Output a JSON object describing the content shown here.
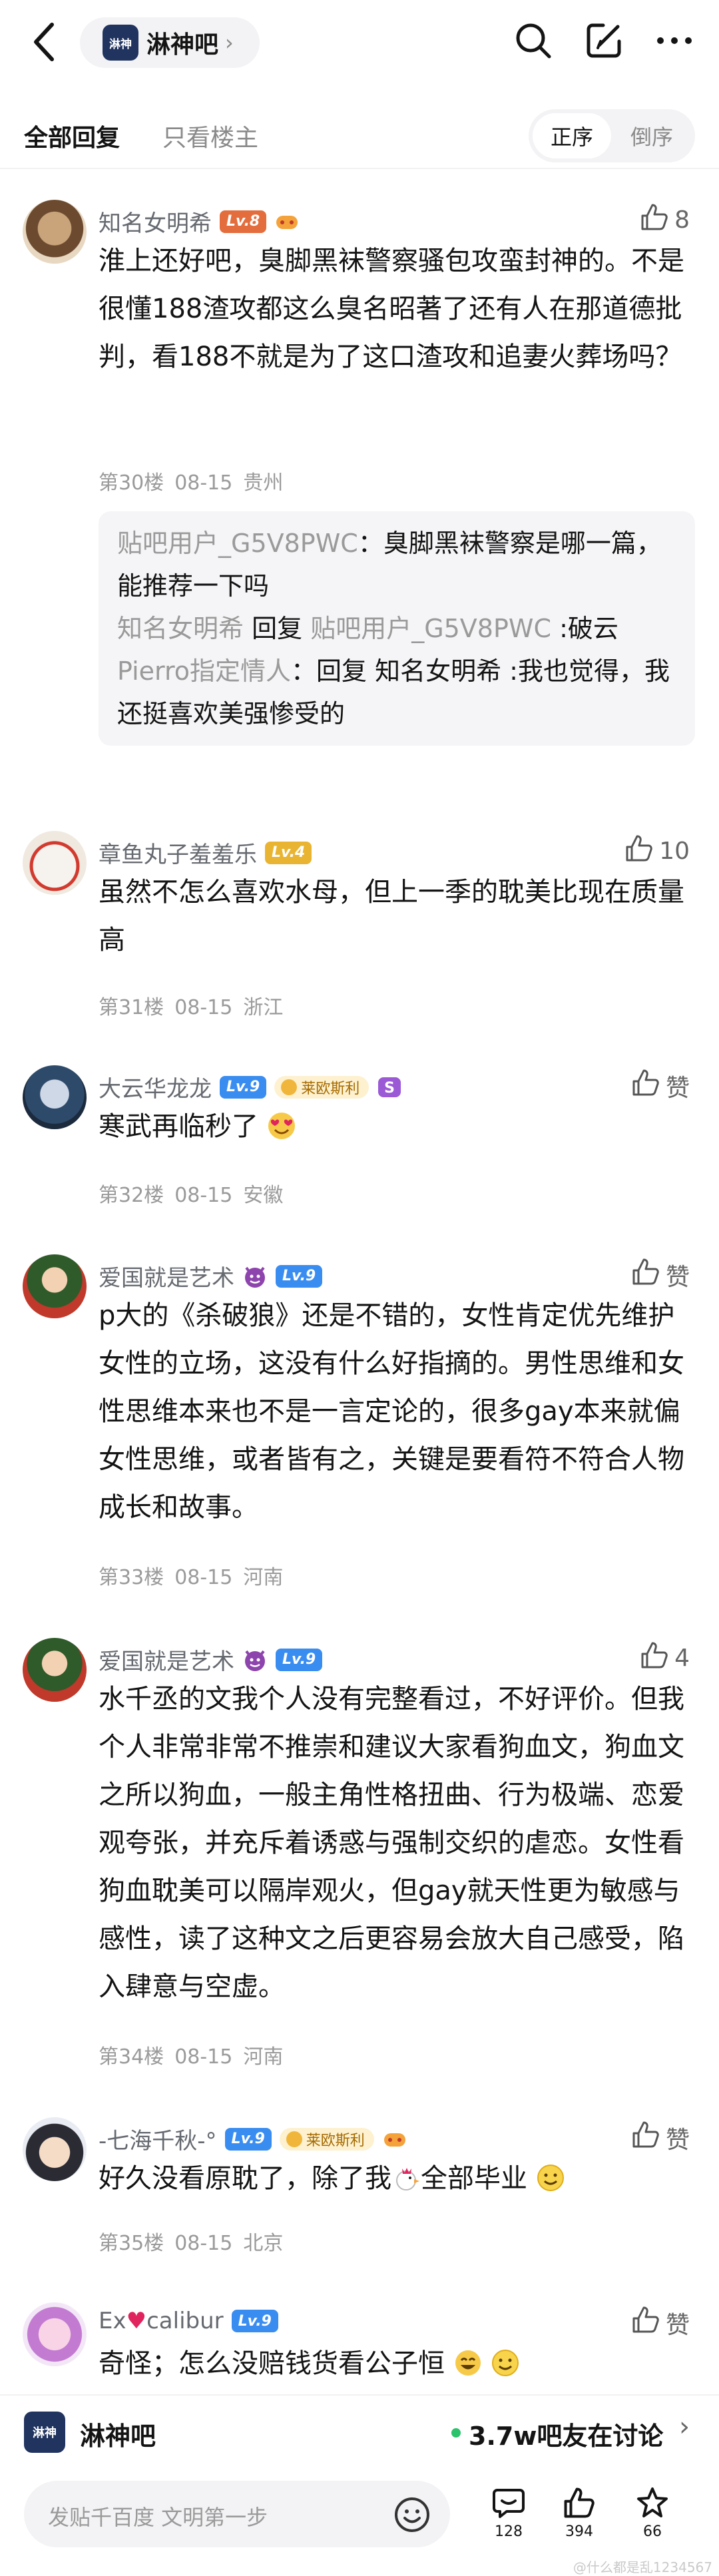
{
  "header": {
    "forum_logo_text": "淋神",
    "forum_name": "淋神吧",
    "icons": [
      "back-icon",
      "search-icon",
      "edit-icon",
      "more-icon"
    ]
  },
  "filters": {
    "tab_all": "全部回复",
    "tab_op": "只看楼主",
    "order_asc": "正序",
    "order_desc": "倒序"
  },
  "posts": [
    {
      "user": "知名女明希",
      "level": "Lv.8",
      "likes": "8",
      "text": "淮上还好吧，臭脚黑袜警察骚包攻蛮封神的。不是很懂188渣攻都这么臭名昭著了还有人在那道德批判，看188不就是为了这口渣攻和追妻火葬场吗？",
      "floor": "第30楼",
      "date": "08-15",
      "location": "贵州",
      "replies": [
        {
          "who": "贴吧用户_G5V8PWC",
          "text": "：臭脚黑袜警察是哪一篇，能推荐一下吗"
        },
        {
          "who": "知名女明希",
          "mid": " 回复 ",
          "who2": "贴吧用户_G5V8PWC",
          "text": " :破云"
        },
        {
          "who": "Pierro指定情人",
          "text": "：回复 知名女明希 :我也觉得，我还挺喜欢美强惨受的"
        }
      ]
    },
    {
      "user": "章鱼丸子羞羞乐",
      "level": "Lv.4",
      "likes": "10",
      "text": "虽然不怎么喜欢水母，但上一季的耽美比现在质量高",
      "floor": "第31楼",
      "date": "08-15",
      "location": "浙江"
    },
    {
      "user": "大云华龙龙",
      "level": "Lv.9",
      "badge": "莱欧斯利",
      "likes": "赞",
      "text": "寒武再临秒了",
      "floor": "第32楼",
      "date": "08-15",
      "location": "安徽"
    },
    {
      "user": "爱国就是艺术",
      "level": "Lv.9",
      "likes": "赞",
      "text": "p大的《杀破狼》还是不错的，女性肯定优先维护女性的立场，这没有什么好指摘的。男性思维和女性思维本来也不是一言定论的，很多gay本来就偏女性思维，或者皆有之，关键是要看符不符合人物成长和故事。",
      "floor": "第33楼",
      "date": "08-15",
      "location": "河南"
    },
    {
      "user": "爱国就是艺术",
      "level": "Lv.9",
      "likes": "4",
      "text": "水千丞的文我个人没有完整看过，不好评价。但我个人非常非常不推崇和建议大家看狗血文，狗血文之所以狗血，一般主角性格扭曲、行为极端、恋爱观夸张，并充斥着诱惑与强制交织的虐恋。女性看狗血耽美可以隔岸观火，但gay就天性更为敏感与感性，读了这种文之后更容易会放大自己感受，陷入肆意与空虚。",
      "floor": "第34楼",
      "date": "08-15",
      "location": "河南"
    },
    {
      "user": "-七海千秋-°",
      "level": "Lv.9",
      "badge": "莱欧斯利",
      "likes": "赞",
      "text_a": "好久没看原耽了，除了我",
      "text_b": "全部毕业",
      "floor": "第35楼",
      "date": "08-15",
      "location": "北京"
    },
    {
      "user": "Ex",
      "user_b": "calibur",
      "level": "Lv.9",
      "likes": "赞",
      "text": "奇怪；怎么没赔钱货看公子恒"
    }
  ],
  "forum_bar": {
    "logo_text": "淋神",
    "name": "淋神吧",
    "discussing": "3.7w吧友在讨论"
  },
  "input_bar": {
    "placeholder": "发贴千百度 文明第一步",
    "comments": "128",
    "likes": "394",
    "favorites": "66"
  },
  "watermark": "@什么都是乱1234567",
  "colors": {
    "lv8": "#e36d3c",
    "lv4": "#e9b432",
    "lv9": "#3a8df0",
    "text": "#141414",
    "muted": "#9a9a9a",
    "online": "#2bc36b"
  }
}
